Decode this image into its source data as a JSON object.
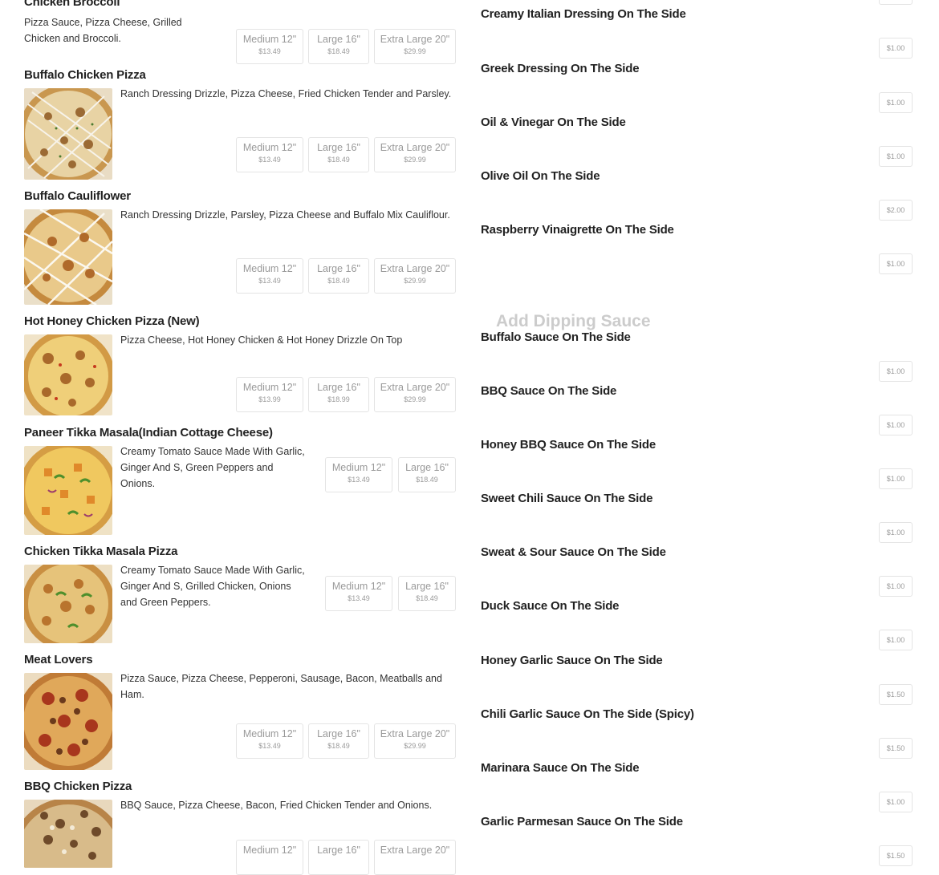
{
  "left_items": [
    {
      "title": "Chicken Broccoli",
      "desc": "Pizza Sauce, Pizza Cheese, Grilled Chicken and Broccoli.",
      "image": "pizza-chicken-broccoli",
      "sizes": [
        {
          "label": "Medium 12\"",
          "price": "$13.49"
        },
        {
          "label": "Large 16\"",
          "price": "$18.49"
        },
        {
          "label": "Extra Large 20\"",
          "price": "$29.99"
        }
      ]
    },
    {
      "title": "Buffalo Chicken Pizza",
      "desc": "Ranch Dressing Drizzle, Pizza Cheese, Fried Chicken Tender and Parsley.",
      "image": "pizza-buffalo-chicken",
      "sizes": [
        {
          "label": "Medium 12\"",
          "price": "$13.49"
        },
        {
          "label": "Large 16\"",
          "price": "$18.49"
        },
        {
          "label": "Extra Large 20\"",
          "price": "$29.99"
        }
      ]
    },
    {
      "title": "Buffalo Cauliflower",
      "desc": "Ranch Dressing Drizzle, Parsley, Pizza Cheese and Buffalo Mix Cauliflour.",
      "image": "pizza-buffalo-cauliflower",
      "sizes": [
        {
          "label": "Medium 12\"",
          "price": "$13.49"
        },
        {
          "label": "Large 16\"",
          "price": "$18.49"
        },
        {
          "label": "Extra Large 20\"",
          "price": "$29.99"
        }
      ]
    },
    {
      "title": "Hot Honey Chicken Pizza (New)",
      "desc": "Pizza Cheese, Hot Honey Chicken & Hot Honey Drizzle On Top",
      "image": "pizza-hot-honey-chicken",
      "sizes": [
        {
          "label": "Medium 12\"",
          "price": "$13.99"
        },
        {
          "label": "Large 16\"",
          "price": "$18.99"
        },
        {
          "label": "Extra Large 20\"",
          "price": "$29.99"
        }
      ]
    },
    {
      "title": "Paneer Tikka Masala(Indian Cottage Cheese)",
      "desc": "Creamy Tomato Sauce Made With Garlic, Ginger And S, Green Peppers and Onions.",
      "image": "pizza-paneer-tikka",
      "sizes": [
        {
          "label": "Medium 12\"",
          "price": "$13.49"
        },
        {
          "label": "Large 16\"",
          "price": "$18.49"
        }
      ]
    },
    {
      "title": "Chicken Tikka Masala Pizza",
      "desc": "Creamy Tomato Sauce Made With Garlic, Ginger And S, Grilled Chicken, Onions and Green Peppers.",
      "image": "pizza-chicken-tikka",
      "sizes": [
        {
          "label": "Medium 12\"",
          "price": "$13.49"
        },
        {
          "label": "Large 16\"",
          "price": "$18.49"
        }
      ]
    },
    {
      "title": "Meat Lovers",
      "desc": "Pizza Sauce, Pizza Cheese, Pepperoni, Sausage, Bacon, Meatballs and Ham.",
      "image": "pizza-meat-lovers",
      "sizes": [
        {
          "label": "Medium 12\"",
          "price": "$13.49"
        },
        {
          "label": "Large 16\"",
          "price": "$18.49"
        },
        {
          "label": "Extra Large 20\"",
          "price": "$29.99"
        }
      ]
    },
    {
      "title": "BBQ Chicken Pizza",
      "desc": "BBQ Sauce, Pizza Cheese, Bacon, Fried Chicken Tender and Onions.",
      "image": "pizza-bbq-chicken",
      "sizes": [
        {
          "label": "Medium 12\"",
          "price": ""
        },
        {
          "label": "Large 16\"",
          "price": ""
        },
        {
          "label": "Extra Large 20\"",
          "price": ""
        }
      ]
    }
  ],
  "dressings": [
    {
      "name": "Creamy Italian Dressing On The Side",
      "price": "$1.00"
    },
    {
      "name": "Greek Dressing On The Side",
      "price": "$1.00"
    },
    {
      "name": "Oil & Vinegar On The Side",
      "price": "$1.00"
    },
    {
      "name": "Olive Oil On The Side",
      "price": "$2.00"
    },
    {
      "name": "Raspberry Vinaigrette On The Side",
      "price": "$1.00"
    }
  ],
  "dipping_section_title": "Add Dipping Sauce",
  "sauces": [
    {
      "name": "Buffalo Sauce On The Side",
      "price": "$1.00"
    },
    {
      "name": "BBQ Sauce On The Side",
      "price": "$1.00"
    },
    {
      "name": "Honey BBQ Sauce On The Side",
      "price": "$1.00"
    },
    {
      "name": "Sweet Chili Sauce On The Side",
      "price": "$1.00"
    },
    {
      "name": "Sweat & Sour Sauce On The Side",
      "price": "$1.00"
    },
    {
      "name": "Duck Sauce On The Side",
      "price": "$1.00"
    },
    {
      "name": "Honey Garlic Sauce On The Side",
      "price": "$1.50"
    },
    {
      "name": "Chili Garlic Sauce On The Side (Spicy)",
      "price": "$1.50"
    },
    {
      "name": "Marinara Sauce On The Side",
      "price": "$1.00"
    },
    {
      "name": "Garlic Parmesan Sauce On The Side",
      "price": "$1.50"
    }
  ]
}
